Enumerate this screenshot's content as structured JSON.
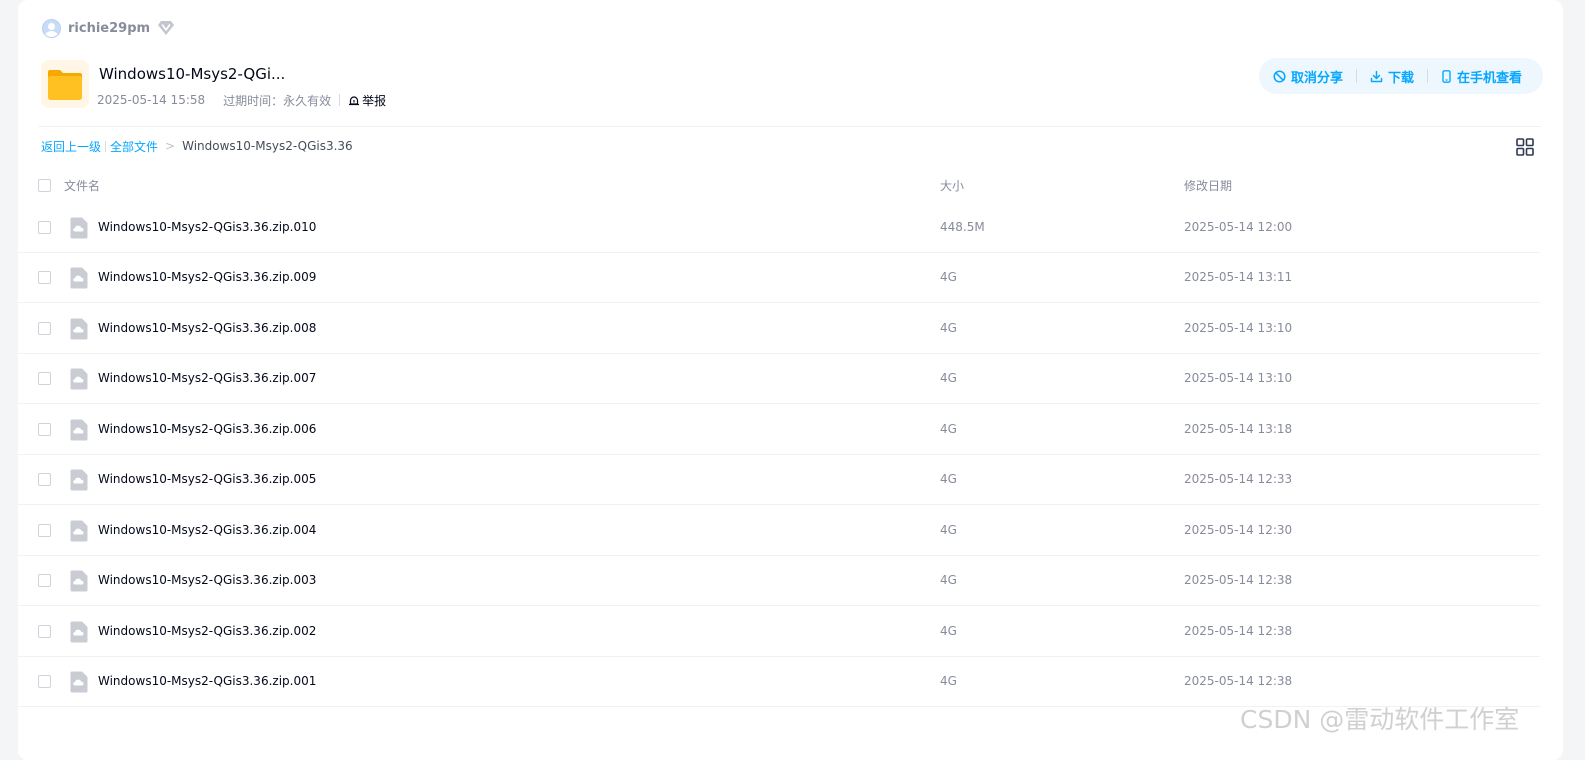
{
  "user": {
    "username": "richie29pm",
    "avatar_icon": "user-avatar",
    "vip_icon": "diamond-icon"
  },
  "share": {
    "title": "Windows10-Msys2-QGi...",
    "date": "2025-05-14 15:58",
    "expiry_label": "过期时间：",
    "expiry_value": "永久有效",
    "report_label": "举报"
  },
  "actions": {
    "cancel_share": "取消分享",
    "download": "下载",
    "view_on_phone": "在手机查看"
  },
  "breadcrumb": {
    "back": "返回上一级",
    "all_files": "全部文件",
    "separator": ">",
    "current": "Windows10-Msys2-QGis3.36"
  },
  "table": {
    "headers": {
      "name": "文件名",
      "size": "大小",
      "modified": "修改日期"
    },
    "rows": [
      {
        "name": "Windows10-Msys2-QGis3.36.zip.010",
        "size": "448.5M",
        "modified": "2025-05-14 12:00"
      },
      {
        "name": "Windows10-Msys2-QGis3.36.zip.009",
        "size": "4G",
        "modified": "2025-05-14 13:11"
      },
      {
        "name": "Windows10-Msys2-QGis3.36.zip.008",
        "size": "4G",
        "modified": "2025-05-14 13:10"
      },
      {
        "name": "Windows10-Msys2-QGis3.36.zip.007",
        "size": "4G",
        "modified": "2025-05-14 13:10"
      },
      {
        "name": "Windows10-Msys2-QGis3.36.zip.006",
        "size": "4G",
        "modified": "2025-05-14 13:18"
      },
      {
        "name": "Windows10-Msys2-QGis3.36.zip.005",
        "size": "4G",
        "modified": "2025-05-14 12:33"
      },
      {
        "name": "Windows10-Msys2-QGis3.36.zip.004",
        "size": "4G",
        "modified": "2025-05-14 12:30"
      },
      {
        "name": "Windows10-Msys2-QGis3.36.zip.003",
        "size": "4G",
        "modified": "2025-05-14 12:38"
      },
      {
        "name": "Windows10-Msys2-QGis3.36.zip.002",
        "size": "4G",
        "modified": "2025-05-14 12:38"
      },
      {
        "name": "Windows10-Msys2-QGis3.36.zip.001",
        "size": "4G",
        "modified": "2025-05-14 12:38"
      }
    ]
  },
  "colors": {
    "accent": "#06a7ff",
    "text_primary": "#03081a",
    "text_secondary": "#878c9c",
    "folder": "#ffc022"
  },
  "watermark": "CSDN @雷动软件工作室"
}
